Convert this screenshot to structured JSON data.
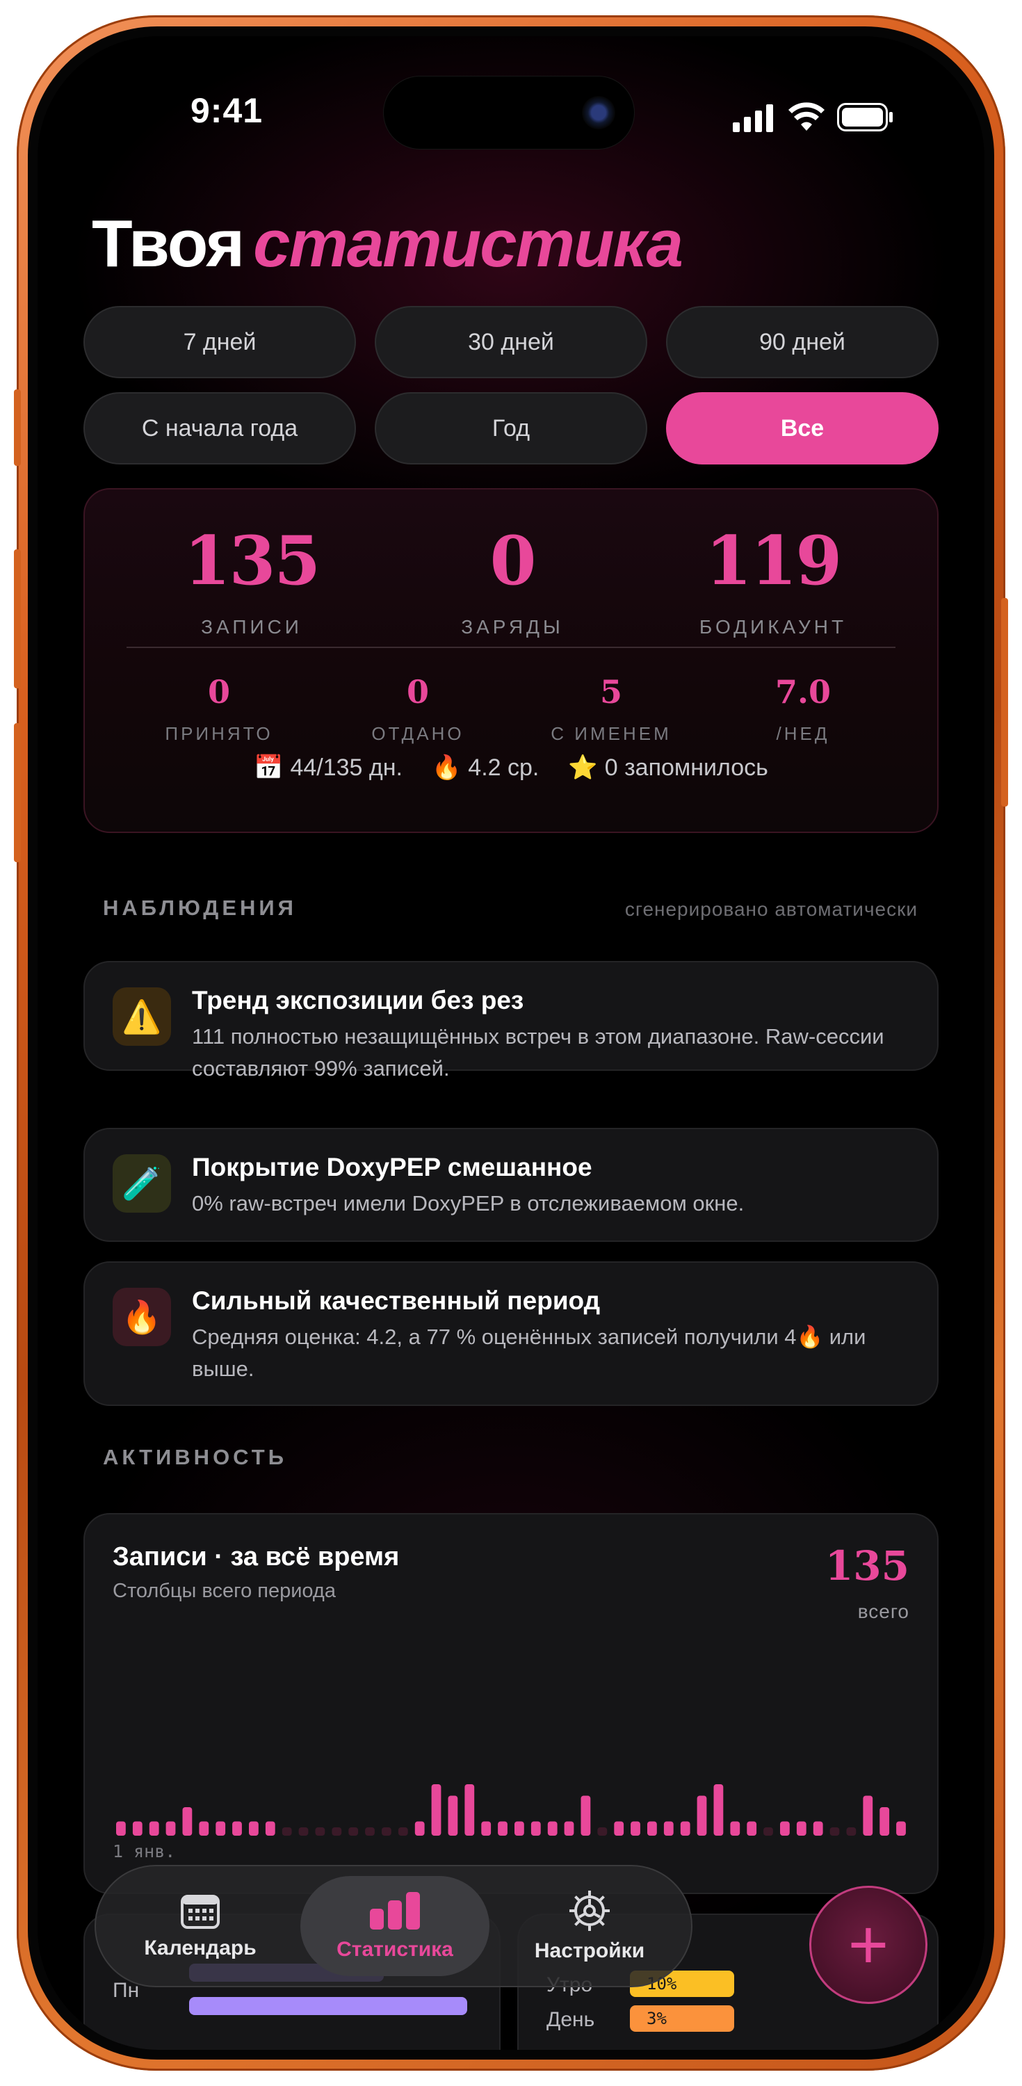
{
  "status_bar": {
    "time": "9:41"
  },
  "header": {
    "title_plain": "Твоя",
    "title_accent": "статистика"
  },
  "periods": [
    {
      "label": "7 дней",
      "active": false
    },
    {
      "label": "30 дней",
      "active": false
    },
    {
      "label": "90 дней",
      "active": false
    },
    {
      "label": "С начала года",
      "active": false
    },
    {
      "label": "Год",
      "active": false
    },
    {
      "label": "Все",
      "active": true
    }
  ],
  "summary": {
    "primary": [
      {
        "value": "135",
        "label": "ЗАПИСИ"
      },
      {
        "value": "0",
        "label": "ЗАРЯДЫ"
      },
      {
        "value": "119",
        "label": "БОДИКАУНТ"
      }
    ],
    "secondary": [
      {
        "value": "0",
        "label": "ПРИНЯТО"
      },
      {
        "value": "0",
        "label": "ОТДАНО"
      },
      {
        "value": "5",
        "label": "С ИМЕНЕМ"
      },
      {
        "value": "7.0",
        "label": "/НЕД"
      }
    ],
    "chips": [
      {
        "icon": "calendar-icon",
        "glyph": "📅",
        "text": "44/135 дн."
      },
      {
        "icon": "fire-icon",
        "glyph": "🔥",
        "text": "4.2 ср."
      },
      {
        "icon": "star-icon",
        "glyph": "⭐",
        "text": "0 запомнилось"
      }
    ]
  },
  "insights": {
    "heading": "НАБЛЮДЕНИЯ",
    "note": "сгенерировано автоматически",
    "items": [
      {
        "icon": "warning-icon",
        "glyph": "⚠️",
        "icon_bg": "#3a2a10",
        "title": "Тренд экспозиции без рез",
        "body": "111 полностью незащищённых встреч в этом диапазоне. Raw-сессии составляют 99% записей."
      },
      {
        "icon": "test-tube-icon",
        "glyph": "🧪",
        "icon_bg": "#2e3018",
        "title": "Покрытие DoxyPEP смешанное",
        "body": "0% raw-встреч имели DoxyPEP в отслеживаемом окне."
      },
      {
        "icon": "fire-icon",
        "glyph": "🔥",
        "icon_bg": "#3a1a22",
        "title": "Сильный качественный период",
        "body": "Средняя оценка: 4.2, а 77 % оценённых записей получили 4🔥 или выше."
      }
    ]
  },
  "activity": {
    "heading": "АКТИВНОСТЬ",
    "card_title": "Записи · за всё время",
    "card_subtitle": "Столбцы всего периода",
    "total": "135",
    "total_label": "всего",
    "axis_start_label": "1 янв."
  },
  "chart_data": {
    "type": "bar",
    "title": "Записи · за всё время",
    "categories": [
      "1 янв."
    ],
    "values": [
      1,
      1,
      1,
      1,
      2,
      1,
      1,
      1,
      1,
      1,
      0,
      0,
      0,
      0,
      0,
      0,
      0,
      0,
      1,
      4,
      3,
      4,
      1,
      1,
      1,
      1,
      1,
      1,
      3,
      0,
      1,
      1,
      1,
      1,
      1,
      3,
      4,
      1,
      1,
      0,
      1,
      1,
      1,
      0,
      0,
      3,
      2,
      1
    ],
    "colors": {
      "bar": "#e8489a",
      "empty": "#3a1a28"
    }
  },
  "peek_section": {
    "row_label": "Пн",
    "time_rows": [
      {
        "label": "Утро",
        "value": "10%",
        "color": "#fbbf24"
      },
      {
        "label": "День",
        "value": "3%",
        "color": "#fb923c"
      }
    ]
  },
  "tabbar": {
    "tabs": [
      {
        "label": "Календарь",
        "icon": "calendar-grid-icon",
        "active": false
      },
      {
        "label": "Статистика",
        "icon": "bar-chart-icon",
        "active": true
      },
      {
        "label": "Настройки",
        "icon": "gear-icon",
        "active": false
      }
    ],
    "fab_label": "+"
  },
  "colors": {
    "accent": "#e8489a",
    "background": "#000000",
    "card": "#151517"
  }
}
